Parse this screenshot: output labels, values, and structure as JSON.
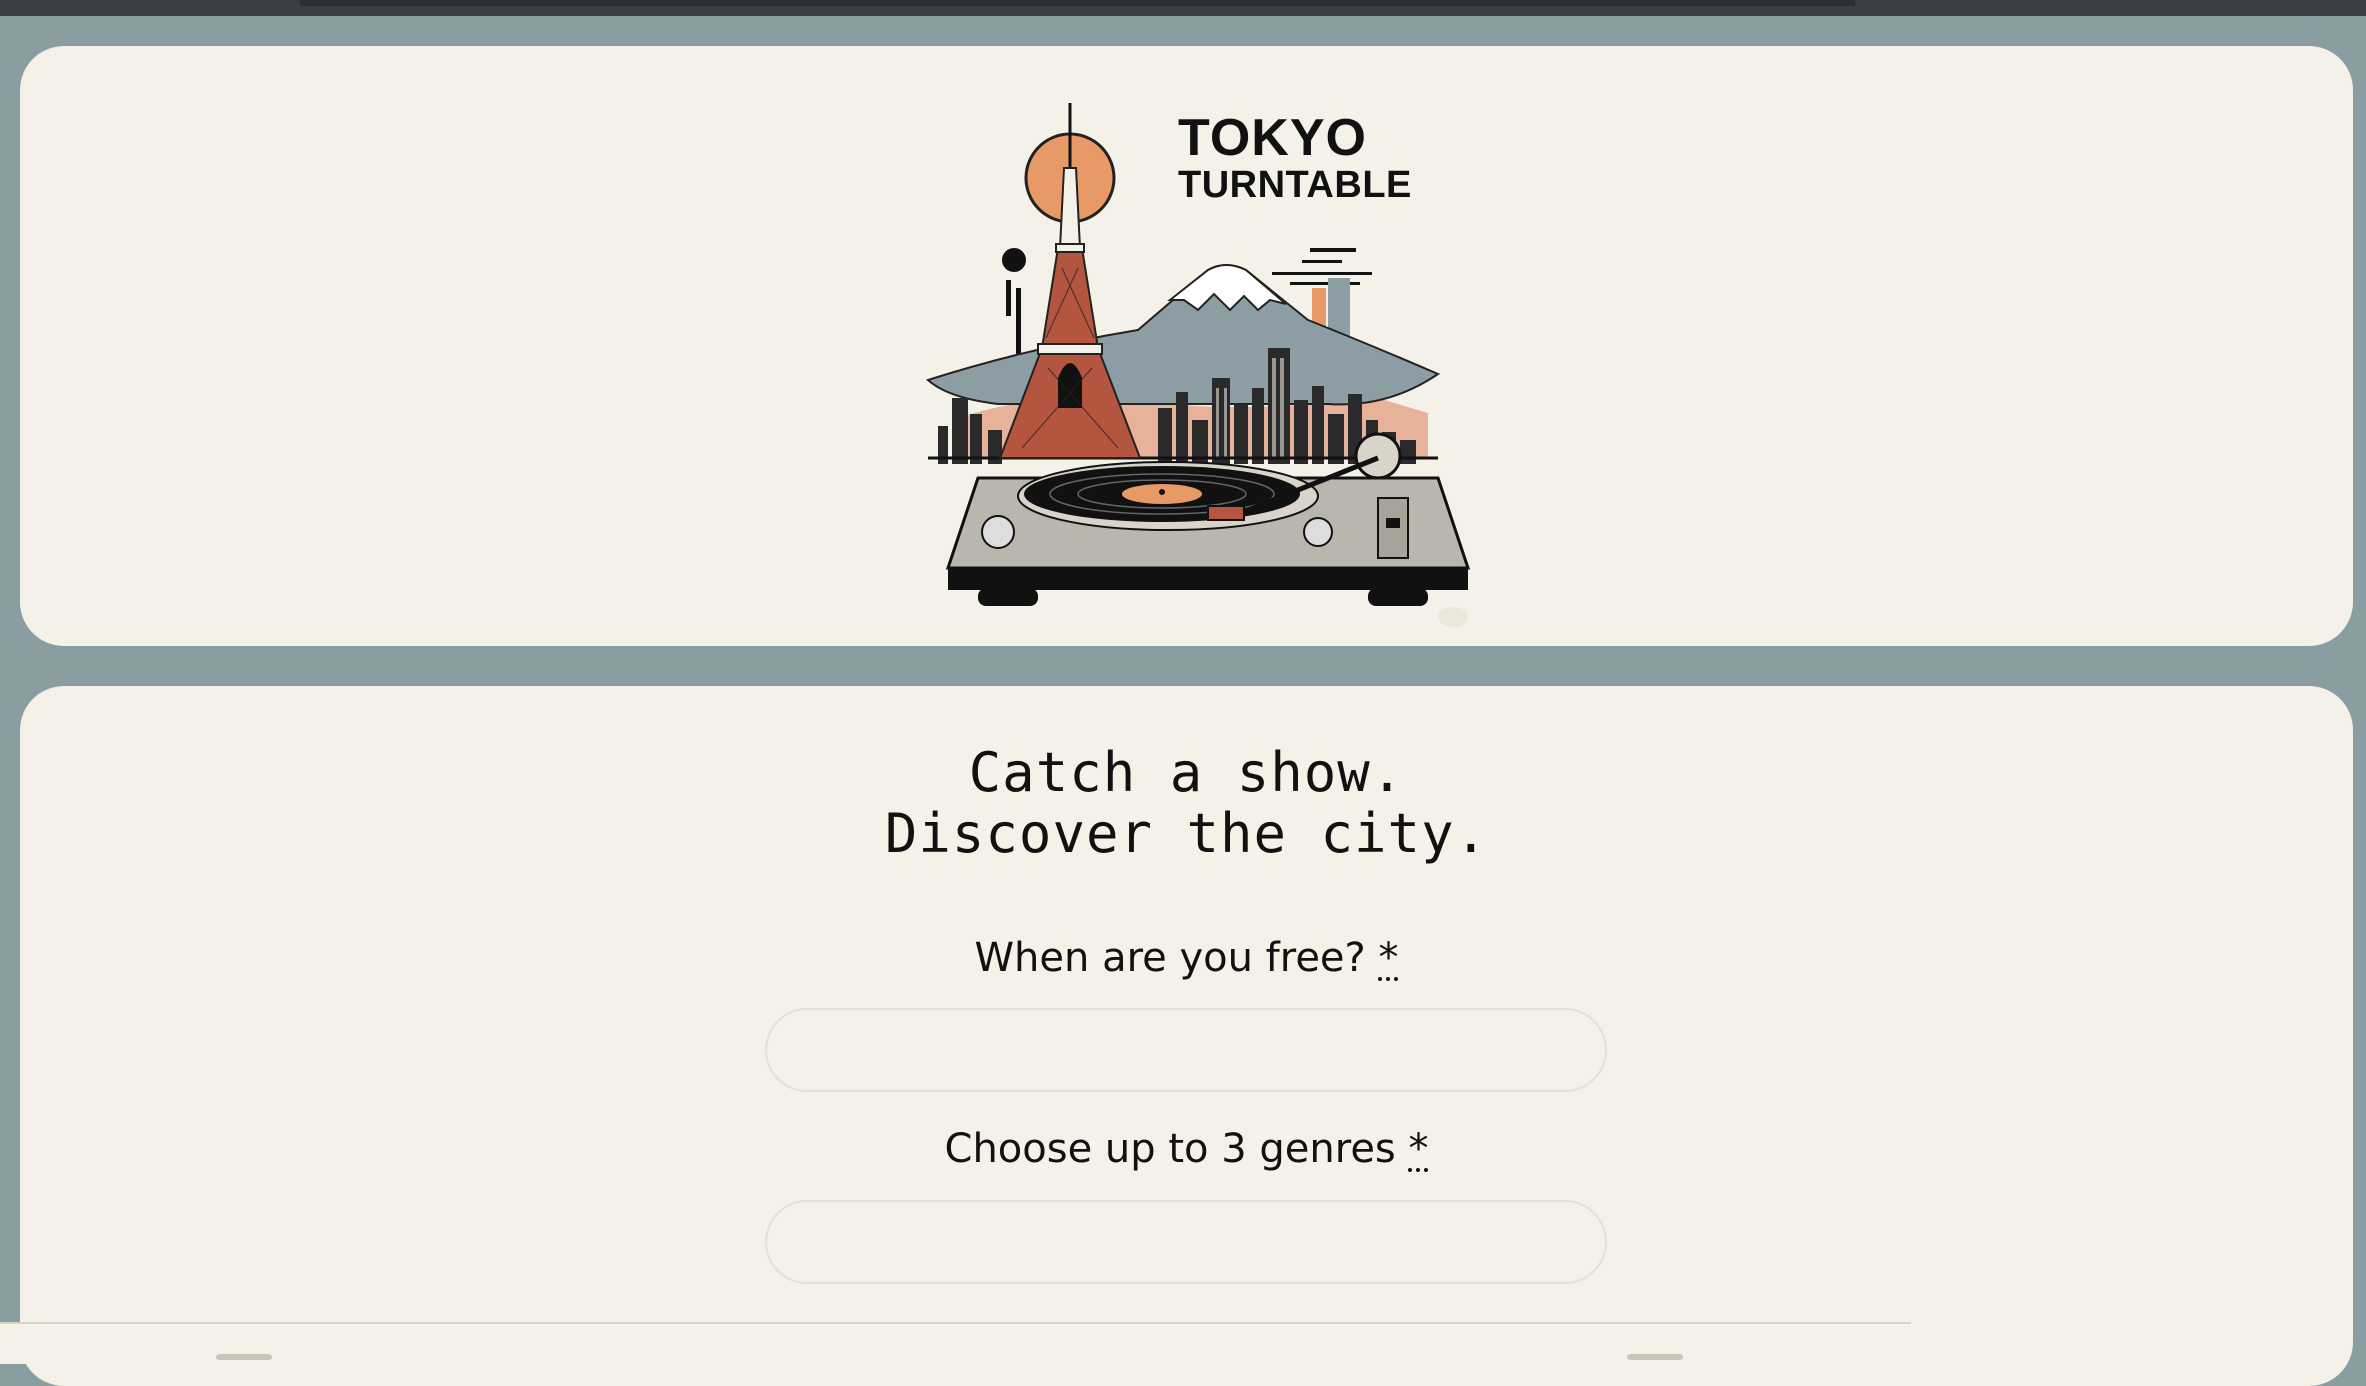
{
  "brand": {
    "line1": "TOKYO",
    "line2": "TURNTABLE"
  },
  "headline": {
    "line1": "Catch a show.",
    "line2": "Discover the city."
  },
  "form": {
    "date_label": "When are you free?",
    "genres_label": "Choose up to 3 genres",
    "required_marker": "*",
    "date_value": "",
    "genres_value": ""
  },
  "colors": {
    "page_bg": "#8a9ea2",
    "card_bg": "#f4f1e8",
    "accent_orange": "#e79a66",
    "tower_red": "#b4553f",
    "mountain_gray": "#8c9ea3"
  }
}
